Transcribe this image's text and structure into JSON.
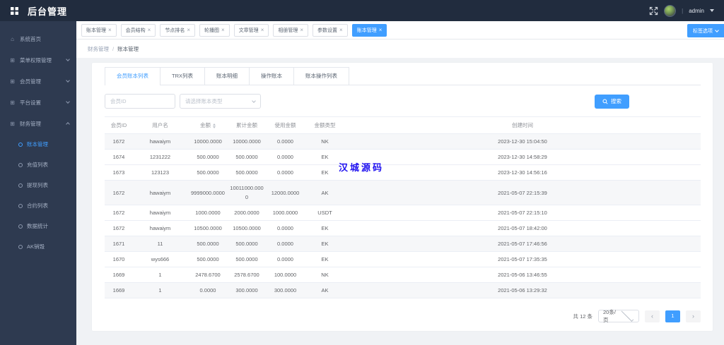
{
  "header": {
    "app_title": "后台管理",
    "username": "admin"
  },
  "tabbar": {
    "tag_options_label": "标签选项",
    "tabs": [
      {
        "label": "账本管理",
        "active": false
      },
      {
        "label": "会员结构",
        "active": false
      },
      {
        "label": "节点排名",
        "active": false
      },
      {
        "label": "轮播图",
        "active": false
      },
      {
        "label": "文章管理",
        "active": false
      },
      {
        "label": "相册管理",
        "active": false
      },
      {
        "label": "参数设置",
        "active": false
      },
      {
        "label": "账本管理",
        "active": true
      }
    ]
  },
  "breadcrumb": {
    "parent": "财务管理",
    "separator": "/",
    "current": "账本管理"
  },
  "sidebar": {
    "items": [
      {
        "id": "home",
        "label": "系统首页",
        "icon": "home-icon",
        "glyph": "⌂",
        "chevron": ""
      },
      {
        "id": "menu-auth",
        "label": "菜单权限管理",
        "icon": "menu-grid-icon",
        "glyph": "⊞",
        "chevron": "down"
      },
      {
        "id": "members",
        "label": "会员管理",
        "icon": "members-icon",
        "glyph": "⊞",
        "chevron": "down"
      },
      {
        "id": "platform",
        "label": "平台设置",
        "icon": "platform-icon",
        "glyph": "⊞",
        "chevron": "down"
      },
      {
        "id": "finance",
        "label": "财务管理",
        "icon": "finance-icon",
        "glyph": "⊞",
        "chevron": "up",
        "children": [
          {
            "id": "ledger",
            "label": "账本管理",
            "active": true
          },
          {
            "id": "recharge",
            "label": "充值列表",
            "active": false
          },
          {
            "id": "withdraw",
            "label": "提现列表",
            "active": false
          },
          {
            "id": "contract",
            "label": "合约列表",
            "active": false
          },
          {
            "id": "stats",
            "label": "数据统计",
            "active": false
          },
          {
            "id": "ak-burn",
            "label": "AK销毁",
            "active": false
          }
        ]
      }
    ]
  },
  "subtabs": [
    "会员账本列表",
    "TRX列表",
    "账本明细",
    "操作账本",
    "账本操作列表"
  ],
  "active_subtab": 0,
  "filters": {
    "member_id_placeholder": "会员ID",
    "type_placeholder": "请选择账本类型",
    "search_label": "搜索"
  },
  "table": {
    "headers": [
      "会员ID",
      "用户名",
      "金额",
      "累计金额",
      "使用金额",
      "金额类型",
      "创建时间"
    ],
    "sortable_column": 2,
    "rows": [
      [
        "1672",
        "hawaiym",
        "10000.0000",
        "10000.0000",
        "0.0000",
        "NK",
        "2023-12-30 15:04:50"
      ],
      [
        "1674",
        "1231222",
        "500.0000",
        "500.0000",
        "0.0000",
        "EK",
        "2023-12-30 14:58:29"
      ],
      [
        "1673",
        "123123",
        "500.0000",
        "500.0000",
        "0.0000",
        "EK",
        "2023-12-30 14:56:16"
      ],
      [
        "1672",
        "hawaiym",
        "9999000.0000",
        "10011000.0000",
        "12000.0000",
        "AK",
        "2021-05-07 22:15:39"
      ],
      [
        "1672",
        "hawaiym",
        "1000.0000",
        "2000.0000",
        "1000.0000",
        "USDT",
        "2021-05-07 22:15:10"
      ],
      [
        "1672",
        "hawaiym",
        "10500.0000",
        "10500.0000",
        "0.0000",
        "EK",
        "2021-05-07 18:42:00"
      ],
      [
        "1671",
        "11",
        "500.0000",
        "500.0000",
        "0.0000",
        "EK",
        "2021-05-07 17:46:56"
      ],
      [
        "1670",
        "wys666",
        "500.0000",
        "500.0000",
        "0.0000",
        "EK",
        "2021-05-07 17:35:35"
      ],
      [
        "1669",
        "1",
        "2478.6700",
        "2578.6700",
        "100.0000",
        "NK",
        "2021-05-06 13:46:55"
      ],
      [
        "1669",
        "1",
        "0.0000",
        "300.0000",
        "300.0000",
        "AK",
        "2021-05-06 13:29:32"
      ]
    ]
  },
  "pagination": {
    "total_text": "共 12 条",
    "page_size": "20条/页",
    "current_page": "1",
    "prev_icon": "‹",
    "next_icon": "›"
  },
  "watermark": "汉城源码",
  "colors": {
    "accent": "#409eff",
    "topbar_bg": "#212c3e",
    "sidebar_bg": "#2e3a50",
    "watermark": "#2012f0",
    "table_border": "#ebeef5"
  }
}
